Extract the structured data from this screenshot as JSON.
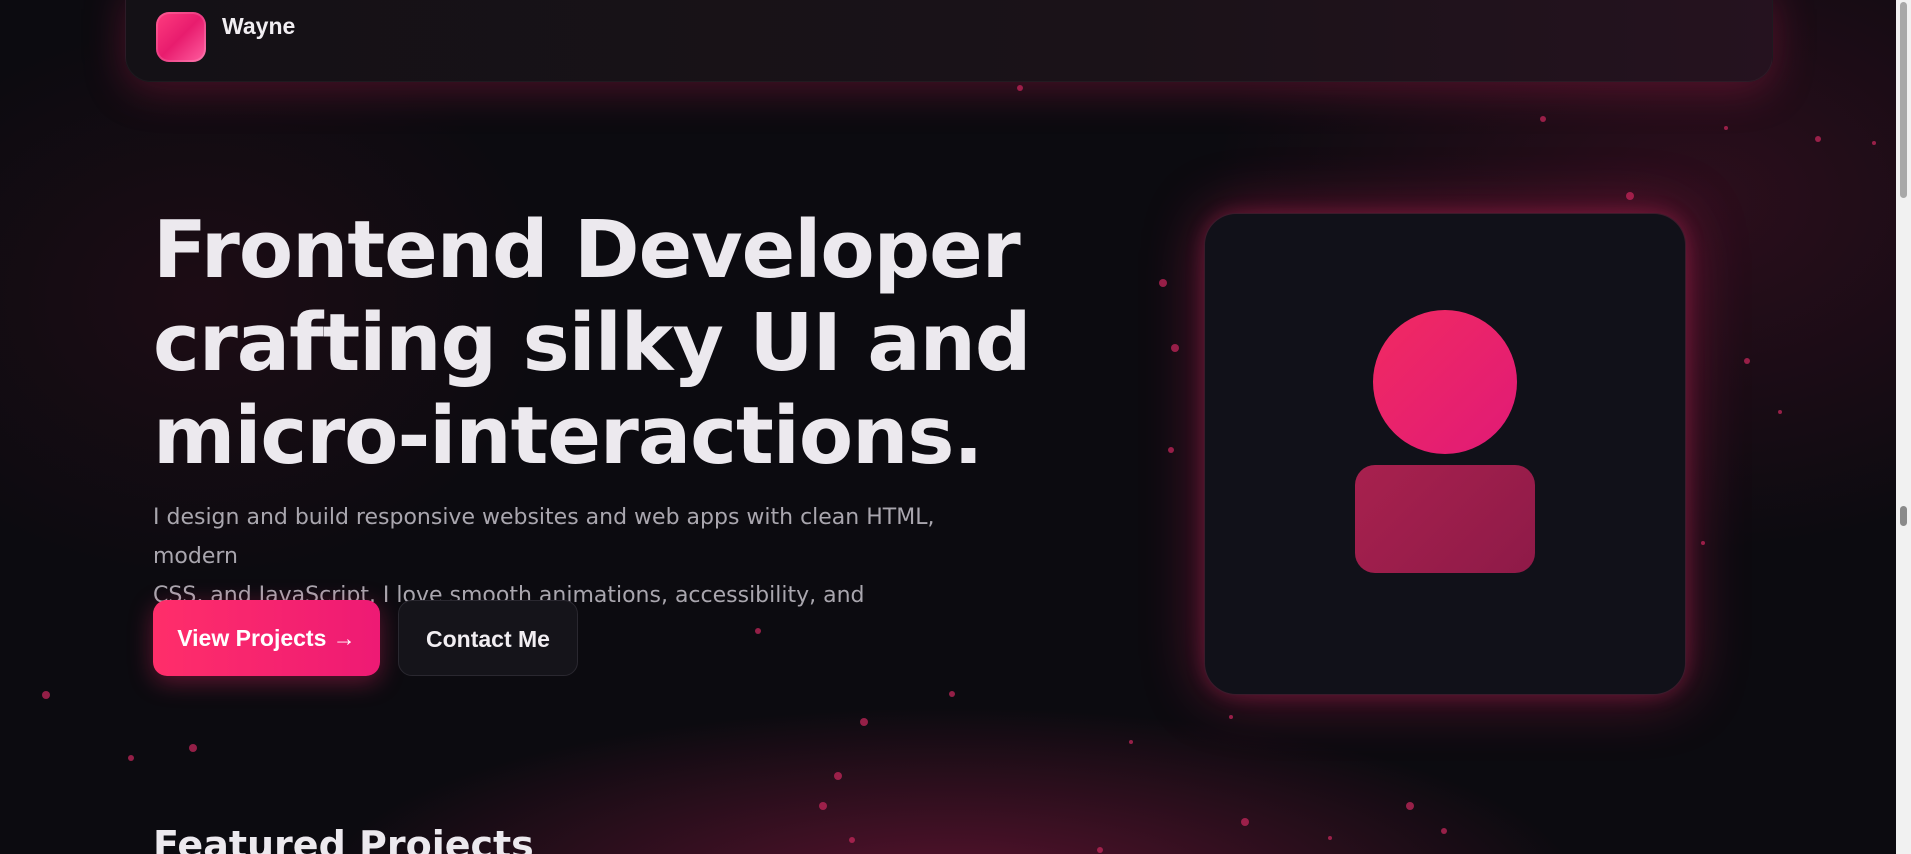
{
  "nav": {
    "brand": "Wayne"
  },
  "hero": {
    "title_lines": [
      "Frontend Developer",
      "crafting silky UI and",
      "micro-interactions."
    ],
    "subtitle_lines": [
      "I design and build responsive websites and web apps with clean HTML, modern",
      "CSS, and JavaScript. I love smooth animations, accessibility, and performance."
    ],
    "primary_button": "View Projects →",
    "secondary_button": "Contact Me"
  },
  "avatar_card": {
    "icon": "user-avatar-icon"
  },
  "sections": {
    "featured_title": "Featured Projects"
  },
  "colors": {
    "accent": "#ff2e6a",
    "accent_secondary": "#e01a76",
    "background": "#0c0b10",
    "text_primary": "#ece9ee",
    "text_muted": "#a9a6ae"
  }
}
